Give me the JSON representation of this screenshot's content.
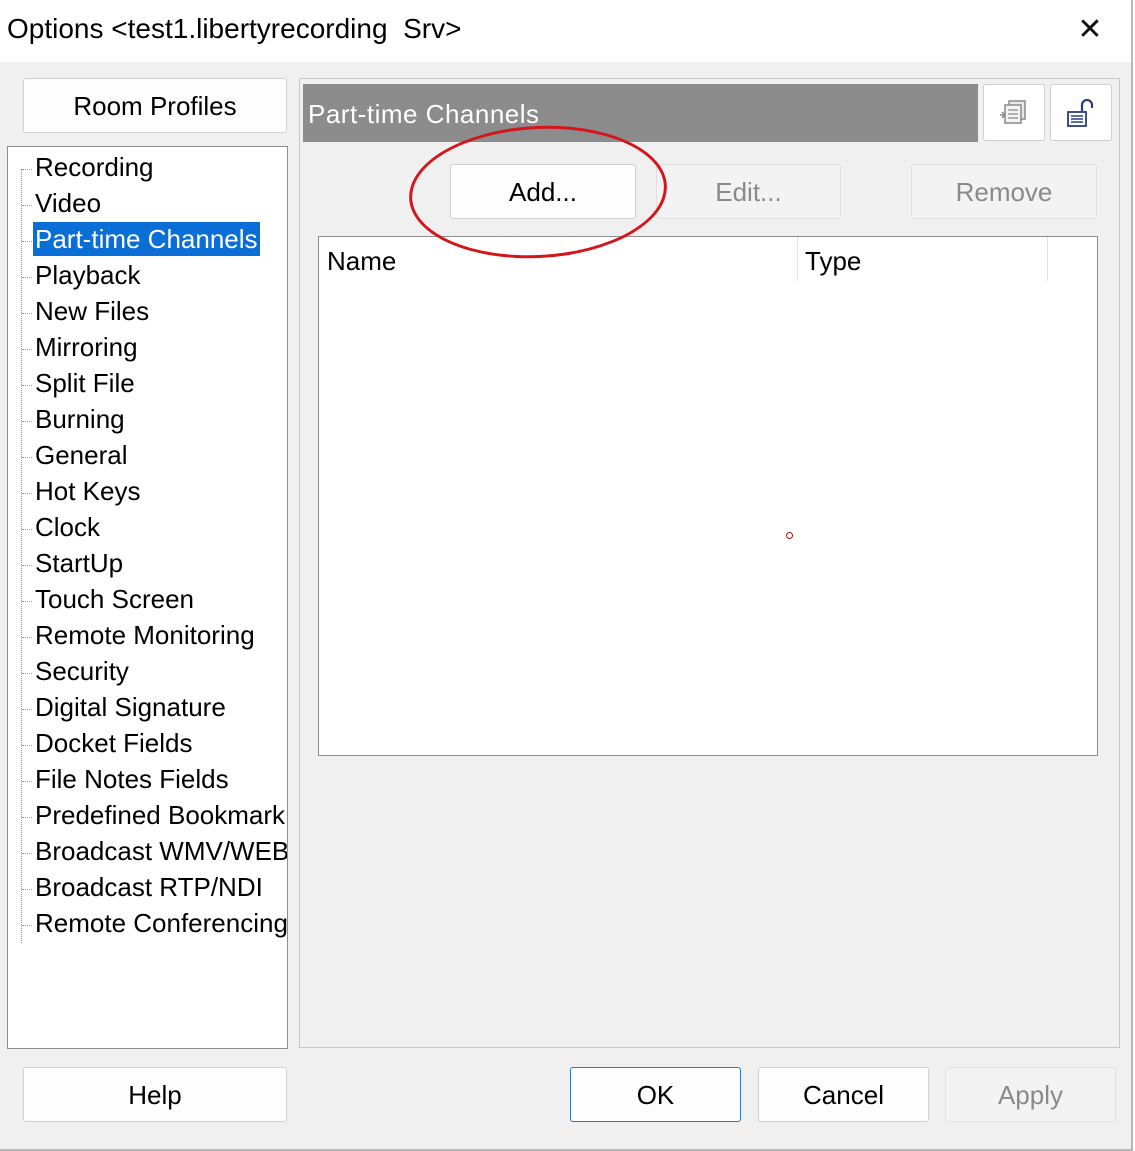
{
  "window": {
    "title": "Options <test1.libertyrecording  Srv>",
    "close_glyph": "✕"
  },
  "sidebar": {
    "room_profiles_label": "Room Profiles",
    "items": [
      {
        "label": "Recording"
      },
      {
        "label": "Video"
      },
      {
        "label": "Part-time Channels",
        "selected": true
      },
      {
        "label": "Playback"
      },
      {
        "label": "New Files"
      },
      {
        "label": "Mirroring"
      },
      {
        "label": "Split File"
      },
      {
        "label": "Burning"
      },
      {
        "label": "General"
      },
      {
        "label": "Hot Keys"
      },
      {
        "label": "Clock"
      },
      {
        "label": "StartUp"
      },
      {
        "label": "Touch Screen"
      },
      {
        "label": "Remote Monitoring"
      },
      {
        "label": "Security"
      },
      {
        "label": "Digital Signature"
      },
      {
        "label": "Docket Fields"
      },
      {
        "label": "File Notes Fields"
      },
      {
        "label": "Predefined Bookmark"
      },
      {
        "label": "Broadcast WMV/WEB"
      },
      {
        "label": "Broadcast RTP/NDI"
      },
      {
        "label": "Remote Conferencing"
      }
    ],
    "selected_color": "#0a6ed7"
  },
  "panel": {
    "title": "Part-time Channels",
    "header_color": "#8c8c8c",
    "icons": [
      "copy-settings-icon",
      "unlock-settings-icon"
    ],
    "buttons": {
      "add": "Add...",
      "edit": "Edit...",
      "remove": "Remove"
    },
    "list": {
      "columns": [
        "Name",
        "Type"
      ],
      "rows": []
    }
  },
  "footer": {
    "help": "Help",
    "ok": "OK",
    "cancel": "Cancel",
    "apply": "Apply"
  },
  "annotation": {
    "color": "#d4161b",
    "target": "add-button"
  }
}
